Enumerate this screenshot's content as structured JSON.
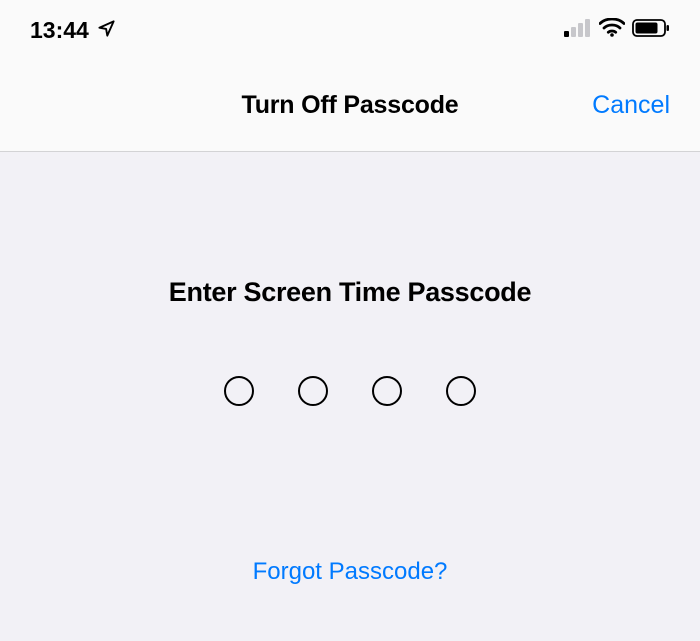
{
  "status_bar": {
    "time": "13:44"
  },
  "nav": {
    "title": "Turn Off Passcode",
    "cancel_label": "Cancel"
  },
  "content": {
    "prompt": "Enter Screen Time Passcode",
    "forgot_label": "Forgot Passcode?"
  },
  "colors": {
    "accent": "#007aff"
  }
}
